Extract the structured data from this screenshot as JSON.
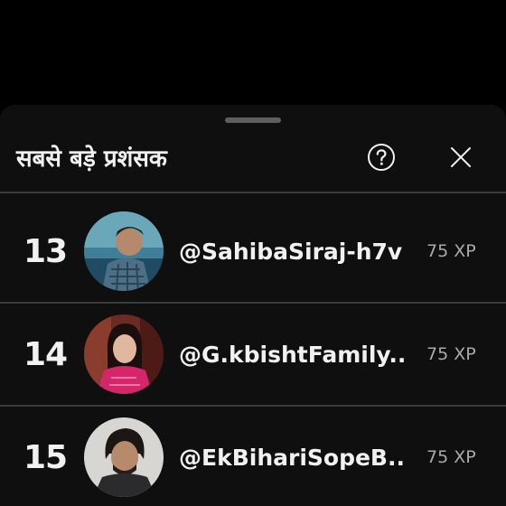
{
  "sheet": {
    "title": "सबसे बड़े प्रशंसक",
    "help_icon": "question-circle-icon",
    "close_icon": "close-icon"
  },
  "fans": [
    {
      "rank": "13",
      "handle": "@SahibaSiraj-h7v",
      "xp": "75 XP"
    },
    {
      "rank": "14",
      "handle": "@G.kbishtFamily...",
      "xp": "75 XP"
    },
    {
      "rank": "15",
      "handle": "@EkBihariSopeB...",
      "xp": "75 XP"
    }
  ],
  "colors": {
    "background": "#000000",
    "sheet": "#0f0f0f",
    "text": "#f1f1f1",
    "secondary_text": "#aaaaaa",
    "divider": "#3a3a3a"
  }
}
